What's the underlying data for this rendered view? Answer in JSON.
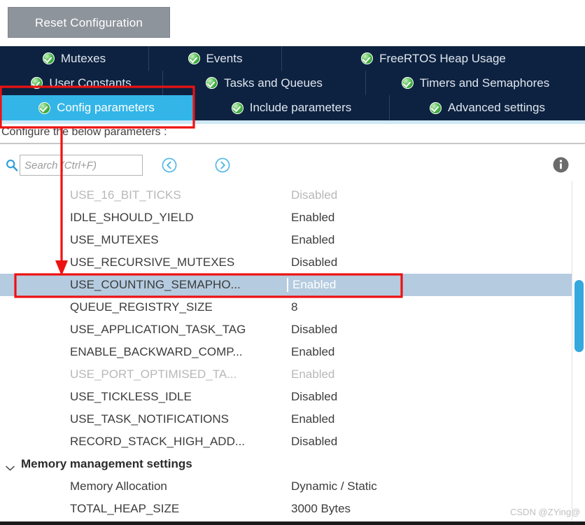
{
  "toolbar": {
    "reset_label": "Reset Configuration"
  },
  "tabs": {
    "row1": [
      {
        "label": "Mutexes",
        "icon": "check-circle-icon",
        "active": false
      },
      {
        "label": "Events",
        "icon": "check-circle-icon",
        "active": false
      },
      {
        "label": "FreeRTOS Heap Usage",
        "icon": "check-circle-icon",
        "active": false
      }
    ],
    "row2": [
      {
        "label": "User Constants",
        "icon": "check-circle-icon",
        "active": false
      },
      {
        "label": "Tasks and Queues",
        "icon": "check-circle-icon",
        "active": false
      },
      {
        "label": "Timers and Semaphores",
        "icon": "check-circle-icon",
        "active": false
      }
    ],
    "row3": [
      {
        "label": "Config parameters",
        "icon": "check-circle-icon",
        "active": true
      },
      {
        "label": "Include parameters",
        "icon": "check-circle-icon",
        "active": false
      },
      {
        "label": "Advanced settings",
        "icon": "check-circle-icon",
        "active": false
      }
    ]
  },
  "content": {
    "configure_label": "Configure the below parameters :"
  },
  "search": {
    "placeholder": "Search (Ctrl+F)",
    "value": "",
    "icon": "search-icon",
    "prev_icon": "circle-chevron-left-icon",
    "next_icon": "circle-chevron-right-icon",
    "info_icon": "info-icon"
  },
  "parameters": [
    {
      "name": "USE_16_BIT_TICKS",
      "value": "Disabled",
      "disabled": true,
      "selected": false
    },
    {
      "name": "IDLE_SHOULD_YIELD",
      "value": "Enabled",
      "disabled": false,
      "selected": false
    },
    {
      "name": "USE_MUTEXES",
      "value": "Enabled",
      "disabled": false,
      "selected": false
    },
    {
      "name": "USE_RECURSIVE_MUTEXES",
      "value": "Disabled",
      "disabled": false,
      "selected": false
    },
    {
      "name": "USE_COUNTING_SEMAPHO...",
      "value": "Enabled",
      "disabled": false,
      "selected": true
    },
    {
      "name": "QUEUE_REGISTRY_SIZE",
      "value": "8",
      "disabled": false,
      "selected": false
    },
    {
      "name": "USE_APPLICATION_TASK_TAG",
      "value": "Disabled",
      "disabled": false,
      "selected": false
    },
    {
      "name": "ENABLE_BACKWARD_COMP...",
      "value": "Enabled",
      "disabled": false,
      "selected": false
    },
    {
      "name": "USE_PORT_OPTIMISED_TA...",
      "value": "Enabled",
      "disabled": true,
      "selected": false
    },
    {
      "name": "USE_TICKLESS_IDLE",
      "value": "Disabled",
      "disabled": false,
      "selected": false
    },
    {
      "name": "USE_TASK_NOTIFICATIONS",
      "value": "Enabled",
      "disabled": false,
      "selected": false
    },
    {
      "name": "RECORD_STACK_HIGH_ADD...",
      "value": "Disabled",
      "disabled": false,
      "selected": false
    }
  ],
  "memory_group": {
    "label": "Memory management settings",
    "chevron_icon": "chevron-down-icon",
    "expanded": true,
    "rows": [
      {
        "name": "Memory Allocation",
        "value": "Dynamic / Static"
      },
      {
        "name": "TOTAL_HEAP_SIZE",
        "value": "3000 Bytes"
      }
    ]
  },
  "scrollbar": {
    "orientation": "vertical",
    "thumb_color": "#35a8de"
  },
  "watermark": {
    "text": "CSDN @ZYing@"
  },
  "annotation": {
    "color": "#ee1111",
    "description": "red box around Config parameters tab with arrow pointing to USE_COUNTING_SEMAPHO... row, and red box around that row"
  },
  "colors": {
    "tab_bar_bg": "#0d2240",
    "tab_active_bg": "#33b5e8",
    "row_selected_bg": "#b5cbe0",
    "reset_button_bg": "#8e949c",
    "annotation_red": "#ee1111"
  }
}
